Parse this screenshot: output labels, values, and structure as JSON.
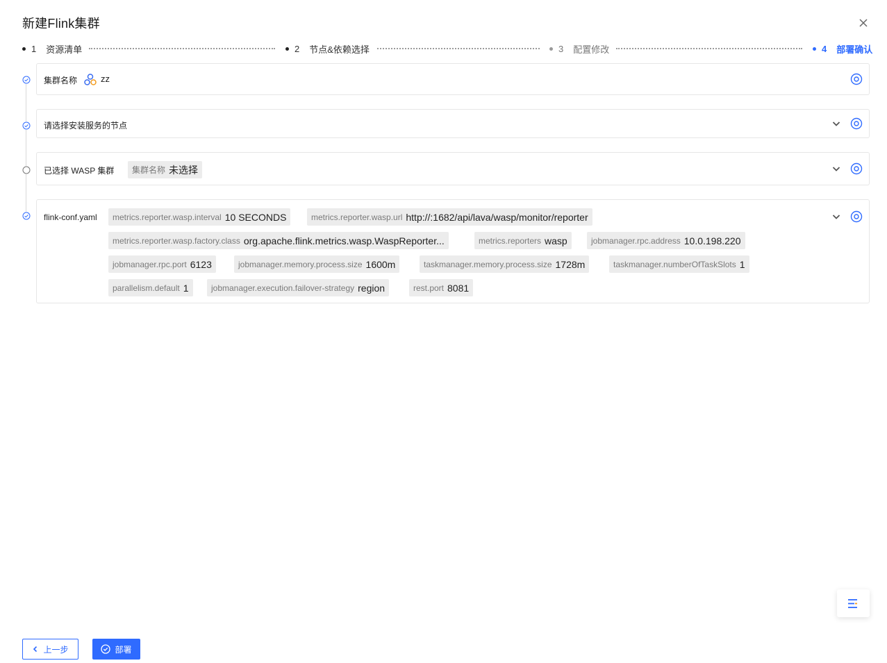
{
  "dialog": {
    "title": "新建Flink集群"
  },
  "steps": [
    {
      "num": "1",
      "label": "资源清单",
      "state": "done"
    },
    {
      "num": "2",
      "label": "节点&依赖选择",
      "state": "done"
    },
    {
      "num": "3",
      "label": "配置修改",
      "state": "pending"
    },
    {
      "num": "4",
      "label": "部署确认",
      "state": "active"
    }
  ],
  "cards": {
    "cluster_name": {
      "label": "集群名称",
      "value": "zz",
      "icon": "cluster-logo-icon"
    },
    "nodes": {
      "label": "请选择安装服务的节点"
    },
    "wasp": {
      "label": "已选择 WASP 集群",
      "tag_key": "集群名称",
      "tag_value": "未选择"
    },
    "flink_conf": {
      "label": "flink-conf.yaml",
      "tags": [
        {
          "key": "metrics.reporter.wasp.interval",
          "value": "10 SECONDS"
        },
        {
          "key": "metrics.reporter.wasp.url",
          "value": "http://:1682/api/lava/wasp/monitor/reporter"
        },
        {
          "key": "metrics.reporter.wasp.factory.class",
          "value": "org.apache.flink.metrics.wasp.WaspReporter..."
        },
        {
          "key": "metrics.reporters",
          "value": "wasp"
        },
        {
          "key": "jobmanager.rpc.address",
          "value": "10.0.198.220"
        },
        {
          "key": "jobmanager.rpc.port",
          "value": "6123"
        },
        {
          "key": "jobmanager.memory.process.size",
          "value": "1600m"
        },
        {
          "key": "taskmanager.memory.process.size",
          "value": "1728m"
        },
        {
          "key": "taskmanager.numberOfTaskSlots",
          "value": "1"
        },
        {
          "key": "parallelism.default",
          "value": "1"
        },
        {
          "key": "jobmanager.execution.failover-strategy",
          "value": "region"
        },
        {
          "key": "rest.port",
          "value": "8081"
        }
      ]
    }
  },
  "footer": {
    "prev_label": "上一步",
    "deploy_label": "部署"
  },
  "colors": {
    "accent": "#2f6bff",
    "tag_bg": "#ececec",
    "border": "#e6e6e6"
  }
}
